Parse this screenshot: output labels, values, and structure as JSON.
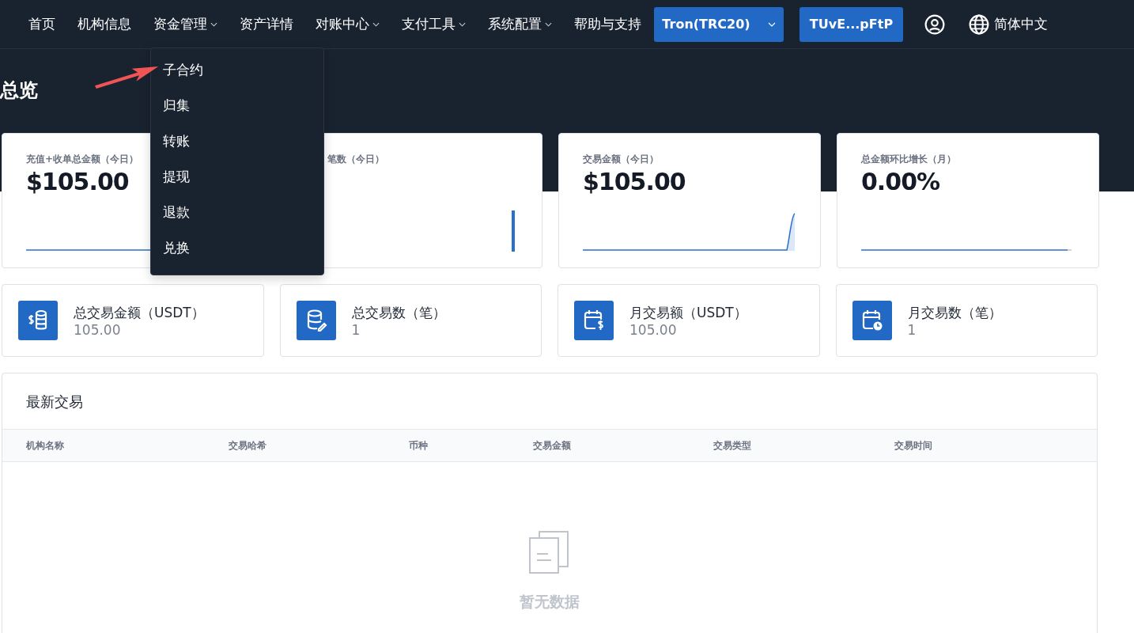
{
  "nav": {
    "items": [
      {
        "label": "首页",
        "has_menu": false
      },
      {
        "label": "机构信息",
        "has_menu": false
      },
      {
        "label": "资金管理",
        "has_menu": true
      },
      {
        "label": "资产详情",
        "has_menu": false
      },
      {
        "label": "对账中心",
        "has_menu": true
      },
      {
        "label": "支付工具",
        "has_menu": true
      },
      {
        "label": "系统配置",
        "has_menu": true
      },
      {
        "label": "帮助与支持",
        "has_menu": false
      }
    ],
    "network_select": "Tron(TRC20)",
    "wallet_button": "TUvE...pFtP",
    "language": "简体中文"
  },
  "dropdown": {
    "items": [
      "子合约",
      "归集",
      "转账",
      "提现",
      "退款",
      "兑换"
    ]
  },
  "page_title": "总览",
  "stat_cards": [
    {
      "title": "充值+收单总金额（今日）",
      "value": "$105.00",
      "kind": "flat"
    },
    {
      "title": "笔数（今日）",
      "kind": "bar"
    },
    {
      "title": "交易金额（今日）",
      "value": "$105.00",
      "kind": "spike"
    },
    {
      "title": "总金额环比增长（月）",
      "value": "0.00%",
      "kind": "tail"
    }
  ],
  "summary_cards": [
    {
      "kind": "coins",
      "label": "总交易金额（USDT）",
      "value": "105.00"
    },
    {
      "kind": "database",
      "label": "总交易数（笔）",
      "value": "1"
    },
    {
      "kind": "calendar",
      "label": "月交易额（USDT）",
      "value": "105.00"
    },
    {
      "kind": "schedule",
      "label": "月交易数（笔）",
      "value": "1"
    }
  ],
  "transactions": {
    "title": "最新交易",
    "columns": [
      "机构名称",
      "交易哈希",
      "币种",
      "交易金额",
      "交易类型",
      "交易时间"
    ],
    "empty_text": "暂无数据"
  }
}
